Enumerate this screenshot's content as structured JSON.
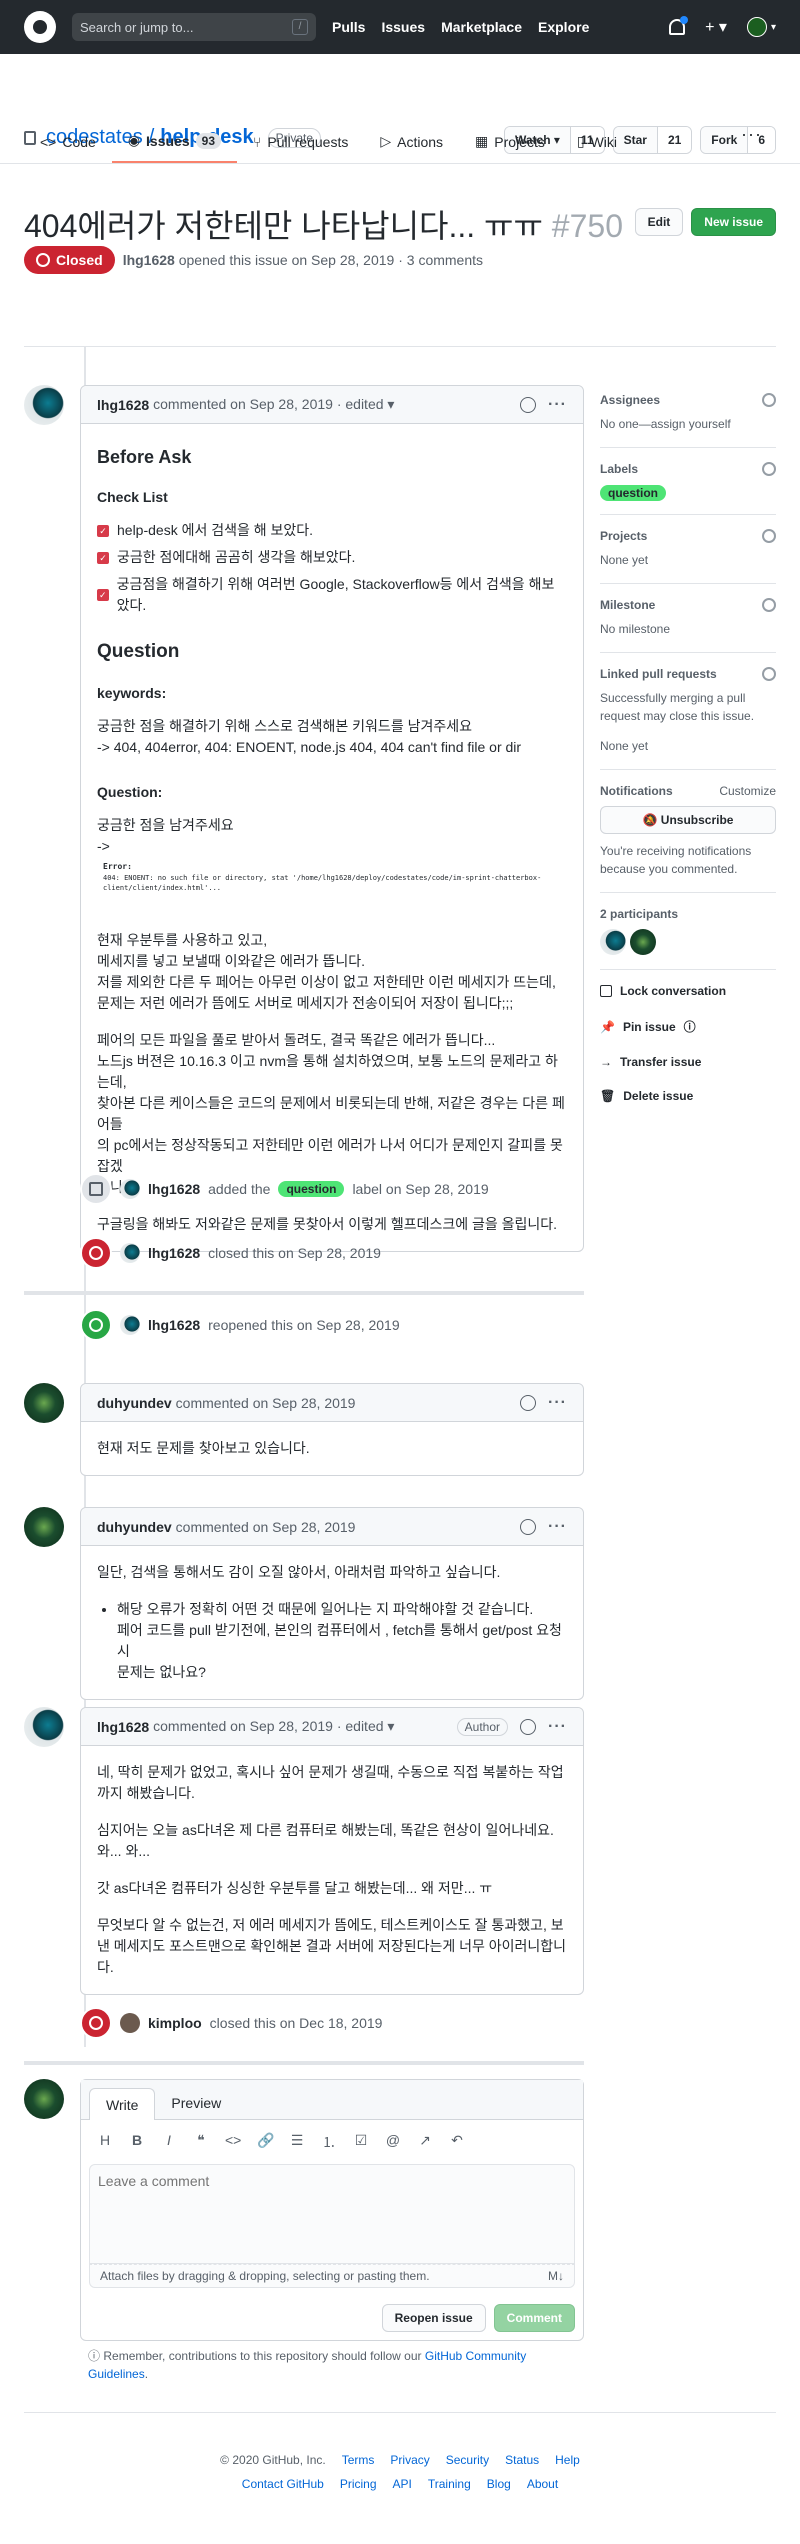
{
  "header": {
    "search_placeholder": "Search or jump to...",
    "search_key": "/",
    "nav": [
      "Pulls",
      "Issues",
      "Marketplace",
      "Explore"
    ],
    "plus": "+ ▾"
  },
  "repo": {
    "owner": "codestates",
    "separator": "/",
    "name": "help-desk",
    "visibility": "Private",
    "watch": {
      "label": "Watch ▾",
      "count": "11"
    },
    "star": {
      "label": "Star",
      "count": "21"
    },
    "fork": {
      "label": "Fork",
      "count": "6"
    },
    "tabs": [
      {
        "label": "Code"
      },
      {
        "label": "Issues",
        "count": "93"
      },
      {
        "label": "Pull requests"
      },
      {
        "label": "Actions"
      },
      {
        "label": "Projects"
      },
      {
        "label": "Wiki"
      }
    ],
    "more": "···"
  },
  "issue": {
    "title": "404에러가 저한테만 나타납니다... ㅠㅠ",
    "number": "#750",
    "edit": "Edit",
    "new_issue": "New issue",
    "state": "Closed",
    "author": "lhg1628",
    "meta": "opened this issue on Sep 28, 2019 · 3 comments"
  },
  "comment1": {
    "author": "lhg1628",
    "meta": "commented on Sep 28, 2019 · edited ▾",
    "h_before": "Before Ask",
    "h_check": "Check List",
    "checks": [
      "help-desk 에서 검색을 해 보았다.",
      "궁금한 점에대해 곰곰히 생각을 해보았다.",
      "궁금점을 해결하기 위해 여러번 Google, Stackoverflow등 에서 검색을 해보았다."
    ],
    "h_question": "Question",
    "h_keywords": "keywords:",
    "kw1": "궁금한 점을 해결하기 위해 스스로 검색해본 키워드를 남겨주세요",
    "kw2": "-> 404, 404error, 404: ENOENT, node.js 404, 404 can't find file or dir",
    "h_q2": "Question:",
    "q1": "궁금한 점을 남겨주세요",
    "q2": "->",
    "err_label": "Error:",
    "err_text": "404: ENOENT: no such file or directory, stat '/home/lhg1628/deploy/codestates/code/im-sprint-chatterbox-client/client/index.html'...",
    "p1": [
      "현재 우분투를 사용하고 있고,",
      "메세지를 넣고 보낼때 이와같은 에러가 뜹니다.",
      "저를 제외한 다른 두 페어는 아무런 이상이 없고 저한테만 이런 메세지가 뜨는데,",
      "문제는 저런 에러가 뜸에도 서버로 메세지가 전송이되어 저장이 됩니다;;;"
    ],
    "p2": [
      "페어의 모든 파일을 풀로 받아서 돌려도, 결국 똑같은 에러가 뜹니다...",
      "노드js 버젼은 10.16.3 이고 nvm을 통해 설치하였으며, 보통 노드의 문제라고 하는데,",
      "찾아본 다른 케이스들은 코드의 문제에서 비롯되는데 반해, 저같은 경우는 다른 페어들",
      "의 pc에서는 정상작동되고 저한테만 이런 에러가 나서 어디가 문제인지 갈피를 못잡겠",
      "습니다."
    ],
    "p3": "구글링을 해봐도 저와같은 문제를 못찾아서 이렇게 헬프데스크에 글을 올립니다."
  },
  "ev_label": {
    "user": "lhg1628",
    "pre": "added the",
    "label": "question",
    "post": "label on Sep 28, 2019"
  },
  "ev_closed1": {
    "user": "lhg1628",
    "text": "closed this on Sep 28, 2019"
  },
  "ev_reopen": {
    "user": "lhg1628",
    "text": "reopened this on Sep 28, 2019"
  },
  "comment2": {
    "author": "duhyundev",
    "meta": "commented on Sep 28, 2019",
    "body": "현재 저도 문제를 찾아보고 있습니다."
  },
  "comment3": {
    "author": "duhyundev",
    "meta": "commented on Sep 28, 2019",
    "p": "일단, 검색을 통해서도 감이 오질 않아서, 아래처럼 파악하고 싶습니다.",
    "li": [
      "해당 오류가 정확히 어떤 것 때문에 일어나는 지 파악해야할 것 같습니다.",
      "페어 코드를 pull 받기전에, 본인의 컴퓨터에서 , fetch를 통해서 get/post 요청시",
      "문제는 없나요?"
    ]
  },
  "comment4": {
    "author": "lhg1628",
    "meta": "commented on Sep 28, 2019 · edited ▾",
    "badge": "Author",
    "p1": "네, 딱히 문제가 없었고, 혹시나 싶어 문제가 생길때, 수동으로 직접 복붙하는 작업까지 해봤습니다.",
    "p2": "심지어는 오늘 as다녀온 제 다른 컴퓨터로 해봤는데, 똑같은 현상이 일어나네요. 와... 와...",
    "p3": "갓 as다녀온 컴퓨터가 싱싱한 우분투를 달고 해봤는데... 왜 저만... ㅠ",
    "p4": "무엇보다 알 수 없는건, 저 에러 메세지가 뜸에도, 테스트케이스도 잘 통과했고, 보낸 메세지도 포스트맨으로 확인해본 결과 서버에 저장된다는게 너무 아이러니합니다."
  },
  "ev_closed2": {
    "user": "kimploo",
    "text": "closed this on Dec 18, 2019"
  },
  "editor": {
    "tab_write": "Write",
    "tab_preview": "Preview",
    "toolbar": [
      "H",
      "B",
      "I",
      "❝",
      "<>",
      "🔗",
      "☰",
      "⒈",
      "☑",
      "@",
      "↗",
      "↶"
    ],
    "placeholder": "Leave a comment",
    "attach": "Attach files by dragging & dropping, selecting or pasting them.",
    "md": "M↓",
    "reopen": "Reopen issue",
    "comment": "Comment"
  },
  "note": {
    "text": "Remember, contributions to this repository should follow our",
    "link": "GitHub Community Guidelines",
    "end": "."
  },
  "sidebar": {
    "assignees": "Assignees",
    "assignees_v": "No one—assign yourself",
    "labels": "Labels",
    "label": "question",
    "projects": "Projects",
    "projects_v": "None yet",
    "milestone": "Milestone",
    "milestone_v": "No milestone",
    "linked": "Linked pull requests",
    "linked_v": "Successfully merging a pull request may close this issue.",
    "linked_v2": "None yet",
    "notif": "Notifications",
    "customize": "Customize",
    "unsub": "Unsubscribe",
    "notif_v": "You're receiving notifications because you commented.",
    "participants": "2 participants",
    "lock": "Lock conversation",
    "pin": "Pin issue",
    "transfer": "Transfer issue",
    "delete": "Delete issue"
  },
  "footer": {
    "copy": "© 2020 GitHub, Inc.",
    "row1": [
      "Terms",
      "Privacy",
      "Security",
      "Status",
      "Help"
    ],
    "row2": [
      "Contact GitHub",
      "Pricing",
      "API",
      "Training",
      "Blog",
      "About"
    ]
  }
}
